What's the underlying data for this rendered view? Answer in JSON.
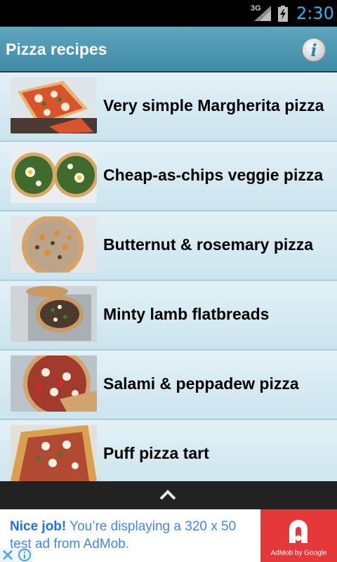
{
  "status_bar": {
    "network": "3G",
    "time": "2:30"
  },
  "app_bar": {
    "title": "Pizza recipes",
    "info_glyph": "i"
  },
  "recipes": [
    {
      "title": "Very simple Margherita pizza",
      "thumb": "margherita"
    },
    {
      "title": "Cheap-as-chips veggie pizza",
      "thumb": "veggie"
    },
    {
      "title": "Butternut & rosemary pizza",
      "thumb": "butternut"
    },
    {
      "title": "Minty lamb flatbreads",
      "thumb": "lamb"
    },
    {
      "title": "Salami & peppadew pizza",
      "thumb": "salami"
    },
    {
      "title": "Puff pizza tart",
      "thumb": "puff"
    }
  ],
  "ad": {
    "headline": "Nice job!",
    "body": " You’re displaying a 320 x 50 test ad from AdMob.",
    "brand": "AdMob by Google",
    "accent": "#e5383b"
  },
  "icons": [
    "signal-icon",
    "battery-charging-icon",
    "info-icon",
    "chevron-up-icon",
    "ad-close-icon",
    "ad-info-icon",
    "admob-logo-icon"
  ]
}
